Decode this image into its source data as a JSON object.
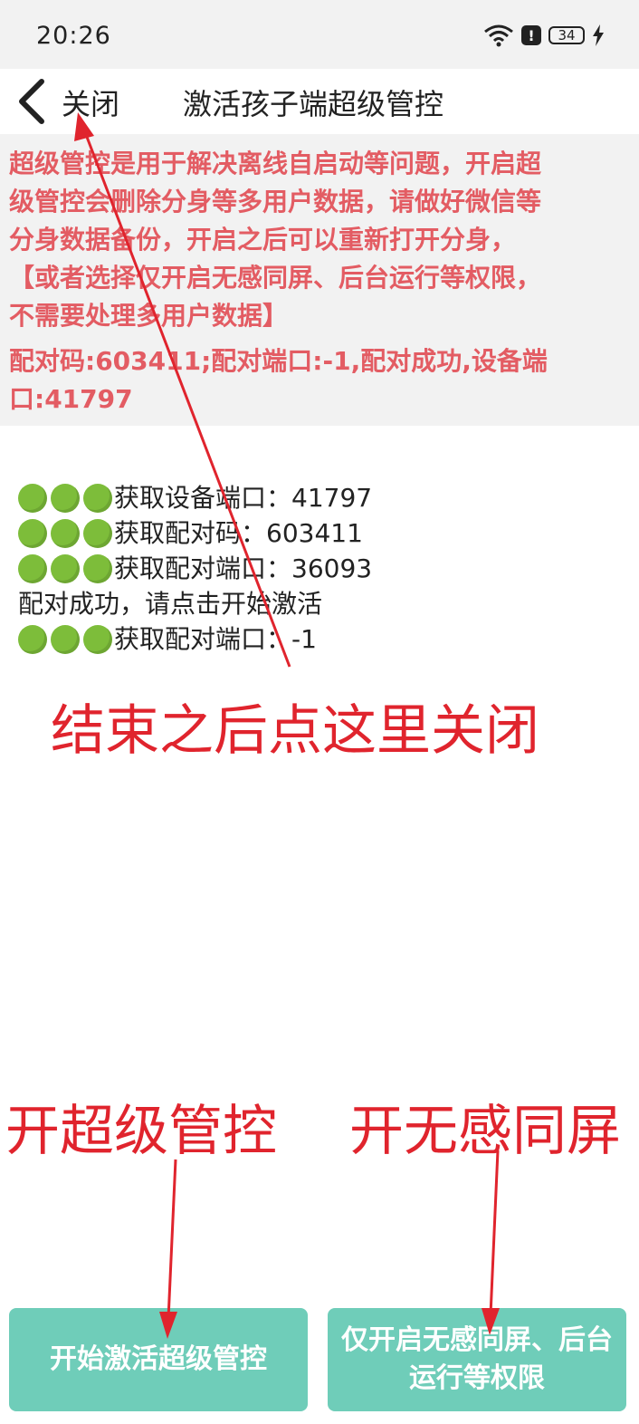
{
  "status_bar": {
    "time": "20:26",
    "battery": "34",
    "alert": "!"
  },
  "titlebar": {
    "close_label": "关闭",
    "title": "激活孩子端超级管控"
  },
  "info": {
    "lines": [
      "超级管控是用于解决离线自启动等问题，开启超",
      "级管控会删除分身等多用户数据，请做好微信等",
      "分身数据备份，开启之后可以重新打开分身，",
      "【或者选择仅开启无感同屏、后台运行等权限，",
      "不需要处理多用户数据】"
    ],
    "pair_lines": [
      "配对码:603411;配对端口:-1,配对成功,设备端",
      "口:41797"
    ]
  },
  "log": [
    {
      "dots": true,
      "text": "获取设备端口：41797"
    },
    {
      "dots": true,
      "text": "获取配对码：603411"
    },
    {
      "dots": true,
      "text": "获取配对端口：36093"
    },
    {
      "dots": false,
      "text": "配对成功，请点击开始激活"
    },
    {
      "dots": true,
      "text": "获取配对端口：-1"
    }
  ],
  "annotations": {
    "close_hint": "结束之后点这里关闭",
    "super_hint": "开超级管控",
    "mirror_hint": "开无感同屏"
  },
  "buttons": {
    "start_super": "开始激活超级管控",
    "mirror_line1": "仅开启无感同屏、后台",
    "mirror_line2": "运行等权限"
  },
  "colors": {
    "accent": "#6fcdb9",
    "warning_text": "#e35c63",
    "annotation": "#e0242d",
    "status_dot": "#7dbd3a"
  },
  "icons": [
    "wifi-icon",
    "alert-icon",
    "battery-icon",
    "charging-icon",
    "back-chevron-icon",
    "status-dot-icon",
    "arrow-annotation-icon"
  ]
}
